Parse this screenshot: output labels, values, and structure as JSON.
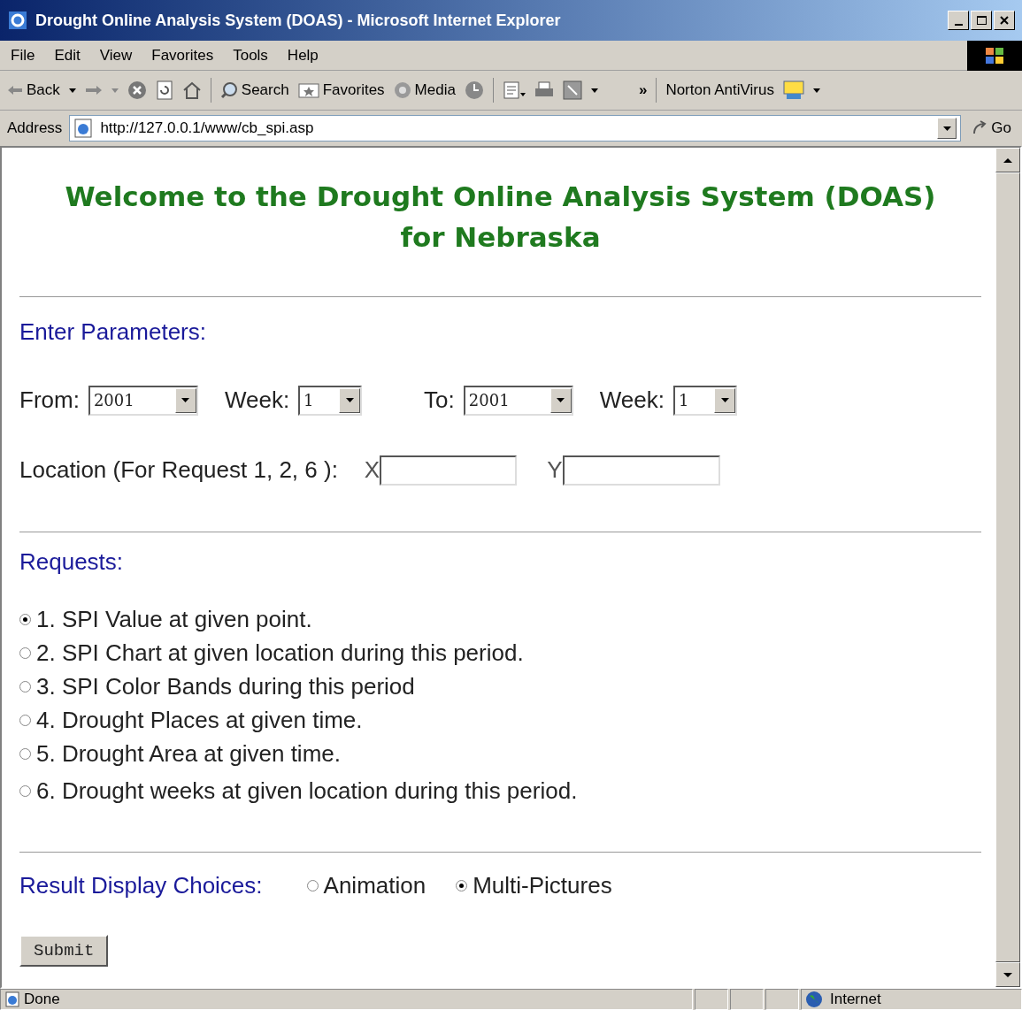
{
  "window": {
    "title": "Drought Online Analysis System (DOAS) - Microsoft Internet Explorer"
  },
  "menu": [
    "File",
    "Edit",
    "View",
    "Favorites",
    "Tools",
    "Help"
  ],
  "toolbar": {
    "back": "Back",
    "search": "Search",
    "favorites": "Favorites",
    "media": "Media",
    "more": "»",
    "norton": "Norton AntiVirus"
  },
  "address": {
    "label": "Address",
    "url": "http://127.0.0.1/www/cb_spi.asp",
    "go": "Go"
  },
  "page": {
    "heading": [
      "Welcome to the Drought Online Analysis System (DOAS)",
      "for Nebraska"
    ],
    "parameters_title": "Enter Parameters:",
    "period": [
      {
        "label": "From:",
        "value": "2001",
        "kind": "year"
      },
      {
        "label": "Week:",
        "value": "1",
        "kind": "week"
      },
      {
        "label": "To:",
        "value": "2001",
        "kind": "year"
      },
      {
        "label": "Week:",
        "value": "1",
        "kind": "week"
      }
    ],
    "location": {
      "label": "Location (For Request 1, 2, 6 ):",
      "x_label": "X",
      "y_label": "Y"
    },
    "requests_title": "Requests:",
    "requests": [
      {
        "label": "1. SPI Value at given point.",
        "selected": true
      },
      {
        "label": "2. SPI Chart at given location during this period.",
        "selected": false
      },
      {
        "label": "3. SPI Color Bands during this period",
        "selected": false
      },
      {
        "label": "4. Drought Places at given time.",
        "selected": false
      },
      {
        "label": "5. Drought Area at given time.",
        "selected": false
      },
      {
        "label": "6. Drought weeks at given location during this period.",
        "selected": false
      }
    ],
    "display_title": "Result Display Choices:",
    "display_choices": [
      {
        "label": "Animation",
        "selected": false
      },
      {
        "label": "Multi-Pictures",
        "selected": true
      }
    ],
    "submit": "Submit"
  },
  "status_bar": {
    "status": "Done",
    "zone": "Internet"
  }
}
